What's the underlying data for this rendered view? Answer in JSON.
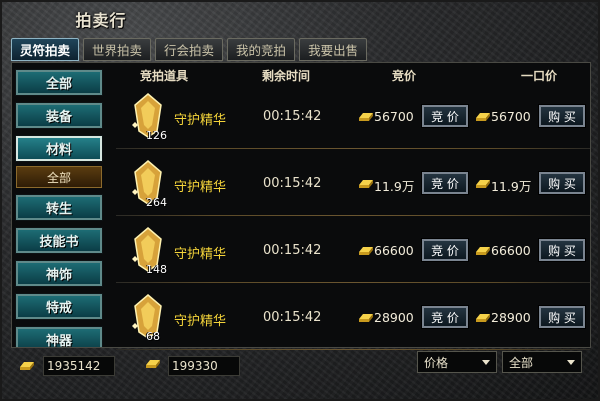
{
  "window": {
    "title": "拍卖行"
  },
  "tabs": [
    {
      "label": "灵符拍卖",
      "active": true
    },
    {
      "label": "世界拍卖",
      "active": false
    },
    {
      "label": "行会拍卖",
      "active": false
    },
    {
      "label": "我的竞拍",
      "active": false
    },
    {
      "label": "我要出售",
      "active": false
    }
  ],
  "categories": {
    "items": [
      "全部",
      "装备",
      "材料",
      "转生",
      "技能书",
      "神饰",
      "特戒",
      "神器"
    ],
    "selected": "材料",
    "selected_sub": "全部"
  },
  "columns": {
    "item": "竞拍道具",
    "time": "剩余时间",
    "bid": "竞价",
    "buyout": "一口价"
  },
  "rows": [
    {
      "name": "守护精华",
      "count": "126",
      "time": "00:15:42",
      "bid_price": "56700",
      "buyout_price": "56700",
      "bid_button": "竞 价",
      "buy_button": "购 买"
    },
    {
      "name": "守护精华",
      "count": "264",
      "time": "00:15:42",
      "bid_price": "11.9万",
      "buyout_price": "11.9万",
      "bid_button": "竞 价",
      "buy_button": "购 买"
    },
    {
      "name": "守护精华",
      "count": "148",
      "time": "00:15:42",
      "bid_price": "66600",
      "buyout_price": "66600",
      "bid_button": "竞 价",
      "buy_button": "购 买"
    },
    {
      "name": "守护精华",
      "count": "68",
      "time": "00:15:42",
      "bid_price": "28900",
      "buyout_price": "28900",
      "bid_button": "竞 价",
      "buy_button": "购 买"
    }
  ],
  "bottom": {
    "gold_amount": "1935142",
    "bound_gold_amount": "199330",
    "sort_select": "价格",
    "filter_select": "全部"
  },
  "colors": {
    "gold": "#f4d43a",
    "tab_active": "#20455a",
    "category": "#1d6c74"
  }
}
